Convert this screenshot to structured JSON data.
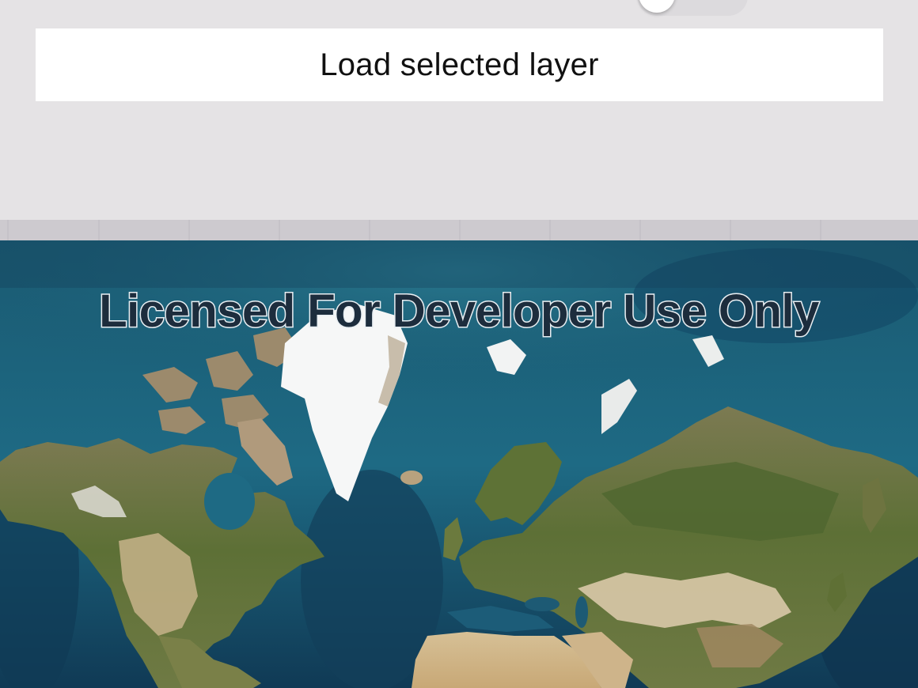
{
  "settings": {
    "load_button_label": "Load selected layer",
    "toggle_state": "on"
  },
  "map": {
    "layer": "world-imagery",
    "watermark": "Licensed For Developer Use Only",
    "colors": {
      "ocean": "#1f5f78",
      "deep_ocean": "#123e57",
      "ice": "#f4f5f5",
      "forest": "#5f7237",
      "desert": "#d8c29a"
    }
  }
}
